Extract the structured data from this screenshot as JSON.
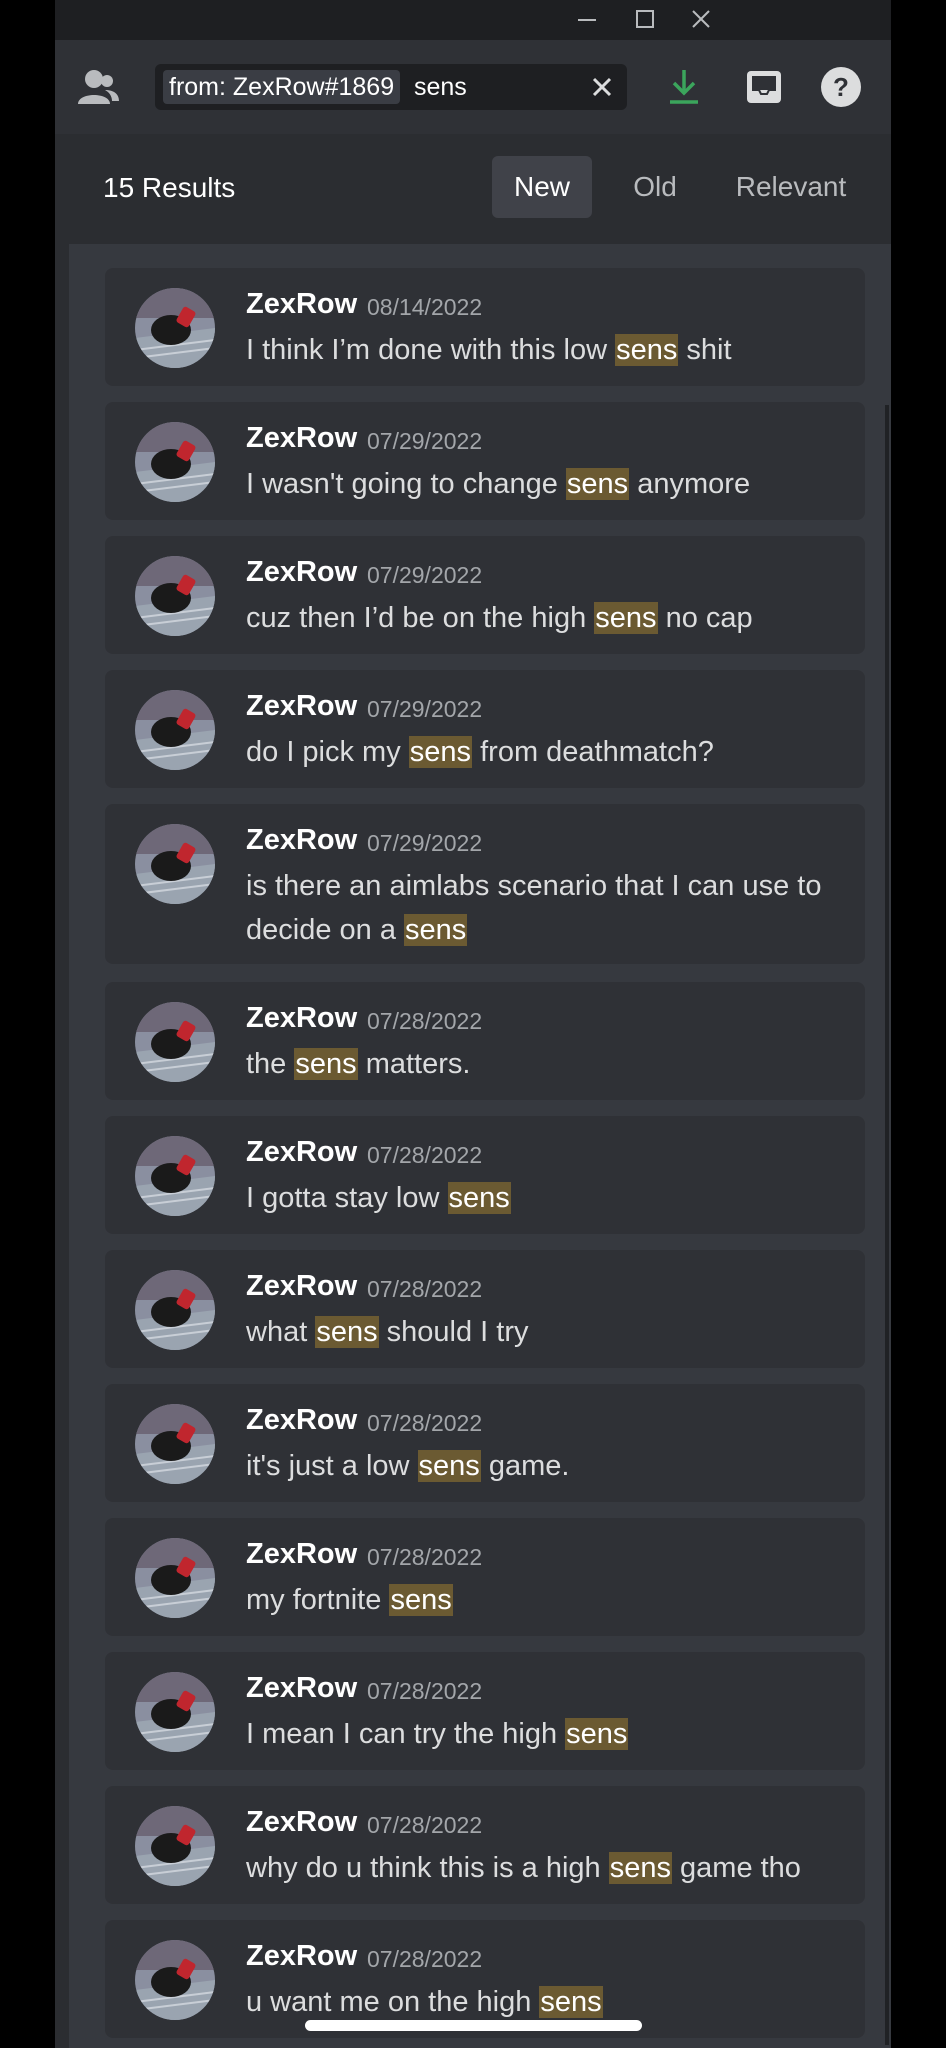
{
  "window": {
    "minimize_label": "minimize",
    "maximize_label": "maximize",
    "close_label": "close"
  },
  "toolbar": {
    "icons": [
      "members-icon",
      "download-icon",
      "inbox-icon",
      "help-icon"
    ],
    "accent_download": "#3ba55c"
  },
  "search": {
    "filter_chip": "from: ZexRow#1869",
    "query": "sens"
  },
  "results": {
    "count_label": "15 Results",
    "sort_tabs": [
      {
        "label": "New",
        "active": true
      },
      {
        "label": "Old",
        "active": false
      },
      {
        "label": "Relevant",
        "active": false
      }
    ],
    "highlight_color": "#6b5a32",
    "items": [
      {
        "author": "ZexRow",
        "date": "08/14/2022",
        "before": "I think I’m done with this low ",
        "match": "sens",
        "after": " shit"
      },
      {
        "author": "ZexRow",
        "date": "07/29/2022",
        "before": "I wasn't going to change ",
        "match": "sens",
        "after": " anymore"
      },
      {
        "author": "ZexRow",
        "date": "07/29/2022",
        "before": "cuz then I’d be on the high ",
        "match": "sens",
        "after": " no cap"
      },
      {
        "author": "ZexRow",
        "date": "07/29/2022",
        "before": "do I pick my ",
        "match": "sens",
        "after": " from deathmatch?"
      },
      {
        "author": "ZexRow",
        "date": "07/29/2022",
        "before": "is there an aimlabs scenario that I can use to decide on a ",
        "match": "sens",
        "after": ""
      },
      {
        "author": "ZexRow",
        "date": "07/28/2022",
        "before": "the ",
        "match": "sens",
        "after": " matters."
      },
      {
        "author": "ZexRow",
        "date": "07/28/2022",
        "before": "I gotta stay low ",
        "match": "sens",
        "after": ""
      },
      {
        "author": "ZexRow",
        "date": "07/28/2022",
        "before": "what ",
        "match": "sens",
        "after": " should I try"
      },
      {
        "author": "ZexRow",
        "date": "07/28/2022",
        "before": "it's just a low ",
        "match": "sens",
        "after": " game."
      },
      {
        "author": "ZexRow",
        "date": "07/28/2022",
        "before": "my fortnite ",
        "match": "sens",
        "after": ""
      },
      {
        "author": "ZexRow",
        "date": "07/28/2022",
        "before": "I mean I can try the high ",
        "match": "sens",
        "after": ""
      },
      {
        "author": "ZexRow",
        "date": "07/28/2022",
        "before": "why do u think this is a high ",
        "match": "sens",
        "after": " game tho"
      },
      {
        "author": "ZexRow",
        "date": "07/28/2022",
        "before": "u want me on the high ",
        "match": "sens",
        "after": ""
      }
    ]
  }
}
